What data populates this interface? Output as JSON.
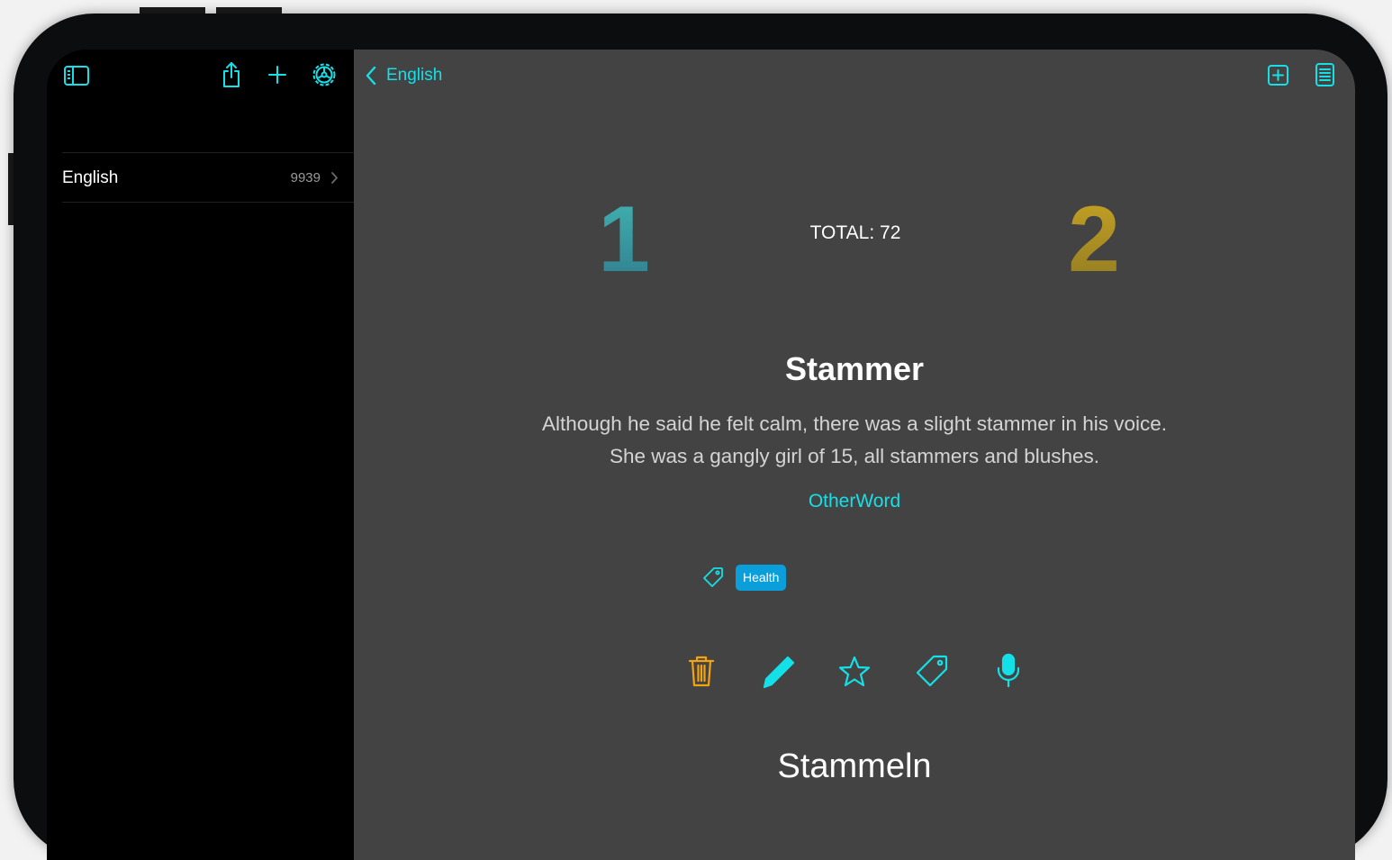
{
  "sidebar": {
    "toolbar": {
      "toggle_icon": "sidebar-toggle-icon",
      "share_icon": "share-icon",
      "add_icon": "plus-icon",
      "settings_icon": "gear-icon"
    },
    "items": [
      {
        "label": "English",
        "count": "9939"
      }
    ]
  },
  "main": {
    "nav": {
      "back_label": "English",
      "add_card_icon": "plus-square-icon",
      "list_icon": "list-icon"
    },
    "stats": {
      "left_number": "1",
      "right_number": "2",
      "total": "TOTAL: 72"
    },
    "card": {
      "word": "Stammer",
      "examples": [
        "Although he said he felt calm, there was a slight stammer in his voice.",
        "She was a gangly girl of 15, all stammers and blushes."
      ],
      "other_word": "OtherWord",
      "tags": [
        "Health"
      ],
      "translation": "Stammeln"
    },
    "actions": [
      "trash-icon",
      "pencil-icon",
      "star-icon",
      "tag-icon",
      "microphone-icon"
    ]
  },
  "colors": {
    "accent": "#14e0e8",
    "tag_bg": "#0a9edb",
    "delete": "#f3a30e",
    "main_bg": "#434343",
    "sidebar_bg": "#000000",
    "left_number_gradient": [
      "#2f7f8f",
      "#43b6b2"
    ],
    "right_number_gradient": [
      "#c9a424",
      "#8f7a22"
    ]
  }
}
